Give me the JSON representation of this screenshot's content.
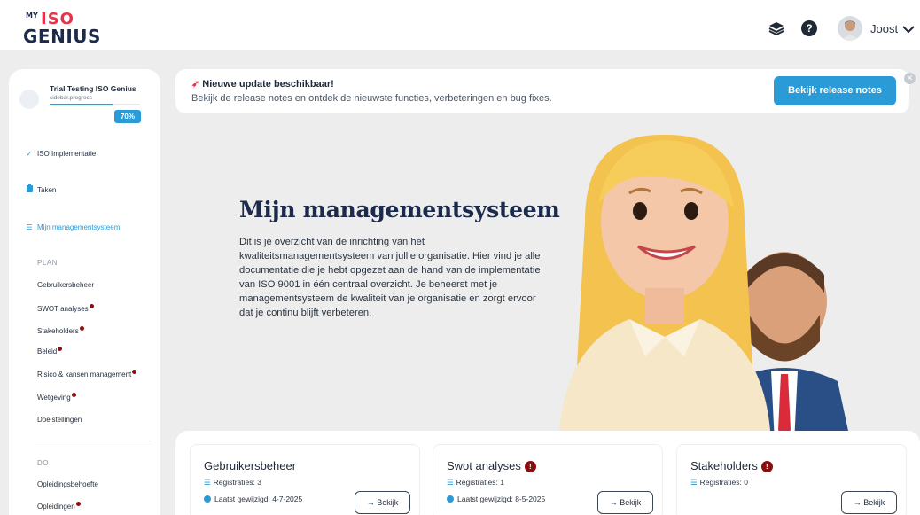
{
  "header": {
    "logo": {
      "my": "MY",
      "iso": "ISO",
      "genius": "GENIUS"
    },
    "user_name": "Joost",
    "icons": [
      "layers-icon",
      "help-icon",
      "avatar",
      "chevron-down-icon"
    ]
  },
  "sidebar": {
    "org_name": "Trial Testing ISO Genius",
    "org_subtitle": "sidebar.progress",
    "progress": 0.7,
    "progress_label": "70%",
    "nav": [
      {
        "label": "ISO Implementatie",
        "icon": "check-icon"
      },
      {
        "label": "Taken",
        "icon": "clipboard-icon"
      },
      {
        "label": "Mijn managementsysteem",
        "icon": "list-icon",
        "active": true
      }
    ],
    "plan_label": "PLAN",
    "plan_items": [
      {
        "label": "Gebruikersbeheer",
        "dot": false
      },
      {
        "label": "SWOT analyses",
        "dot": true
      },
      {
        "label": "Stakeholders",
        "dot": true
      },
      {
        "label": "Beleid",
        "dot": true
      },
      {
        "label": "Risico & kansen management",
        "dot": true
      },
      {
        "label": "Wetgeving",
        "dot": true
      },
      {
        "label": "Doelstellingen",
        "dot": false
      }
    ],
    "do_label": "DO",
    "do_items": [
      {
        "label": "Opleidingsbehoefte",
        "dot": false
      },
      {
        "label": "Opleidingen",
        "dot": true
      }
    ]
  },
  "banner": {
    "title": "Nieuwe update beschikbaar!",
    "text": "Bekijk de release notes en ontdek de nieuwste functies, verbeteringen en bug fixes.",
    "button": "Bekijk release notes"
  },
  "hero": {
    "title": "Mijn managementsysteem",
    "text": "Dit is je overzicht van de inrichting van het kwaliteitsmanagementsysteem van jullie organisatie. Hier vind je alle documentatie die je hebt opgezet aan de hand van de implementatie van ISO 9001 in één centraal overzicht. Je beheerst met je managementsysteem de kwaliteit van je organisatie en zorgt ervoor dat je continu blijft verbeteren."
  },
  "cards": [
    {
      "title": "Gebruikersbeheer",
      "badge": "",
      "registrations": "Registraties: 3",
      "modified": "Laatst gewijzigd: 4-7-2025",
      "button": "→  Bekijk"
    },
    {
      "title": "Swot analyses",
      "badge": "!",
      "registrations": "Registraties: 1",
      "modified": "Laatst gewijzigd: 8-5-2025",
      "button": "→  Bekijk"
    },
    {
      "title": "Stakeholders",
      "badge": "!",
      "registrations": "Registraties: 0",
      "modified": "",
      "button": "→  Bekijk"
    }
  ]
}
